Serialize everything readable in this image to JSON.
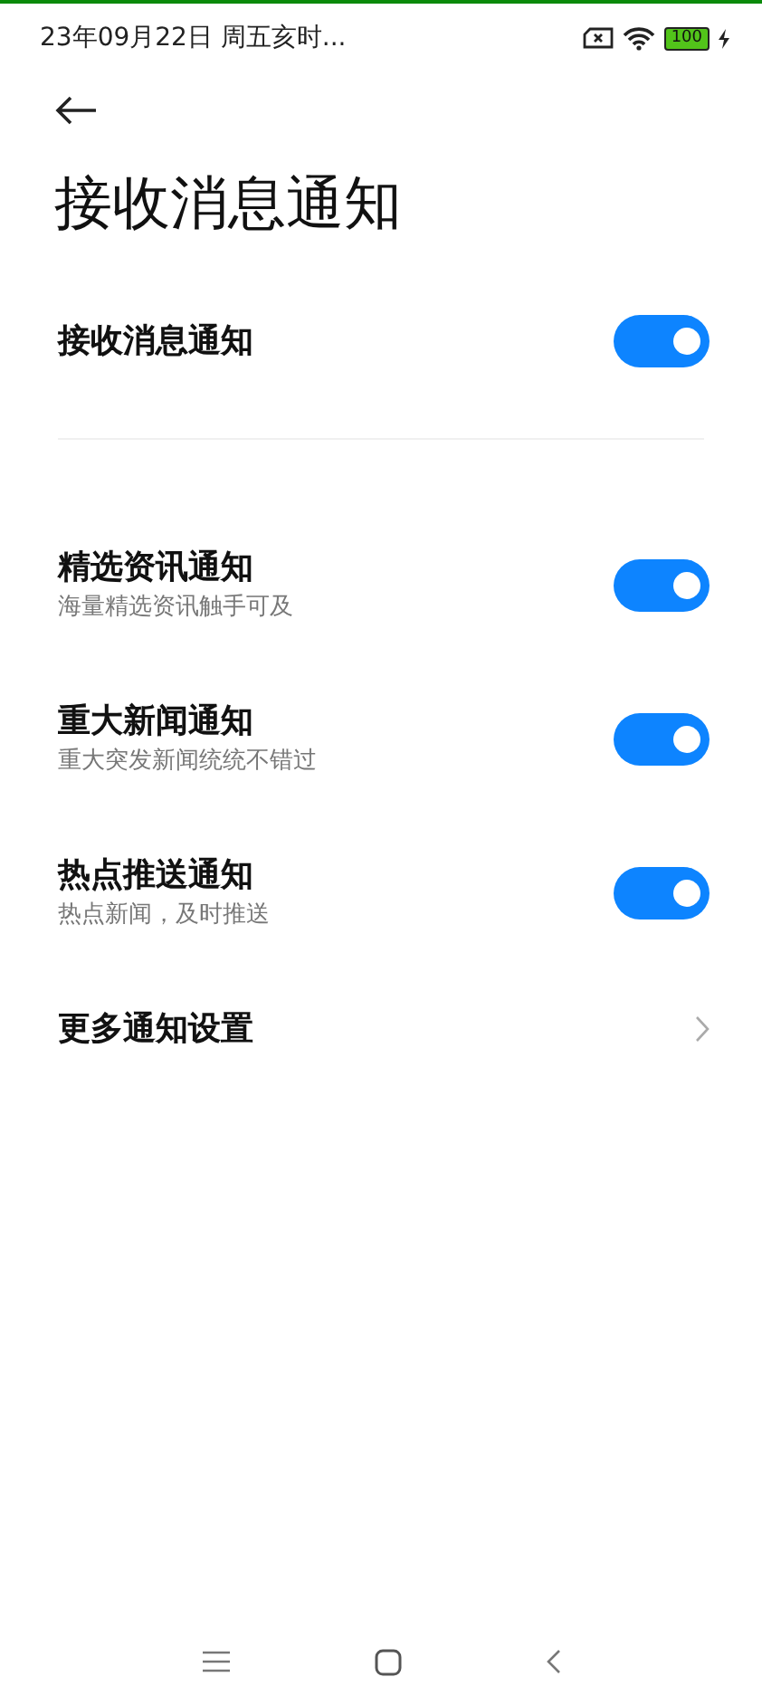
{
  "status_bar": {
    "time": "23年09月22日 周五亥时...",
    "battery": "100"
  },
  "title": "接收消息通知",
  "master": {
    "label": "接收消息通知",
    "on": true
  },
  "items": [
    {
      "kind": "toggle",
      "label": "精选资讯通知",
      "subtitle": "海量精选资讯触手可及",
      "on": true
    },
    {
      "kind": "toggle",
      "label": "重大新闻通知",
      "subtitle": "重大突发新闻统统不错过",
      "on": true
    },
    {
      "kind": "toggle",
      "label": "热点推送通知",
      "subtitle": "热点新闻，及时推送",
      "on": true
    },
    {
      "kind": "link",
      "label": "更多通知设置"
    }
  ]
}
